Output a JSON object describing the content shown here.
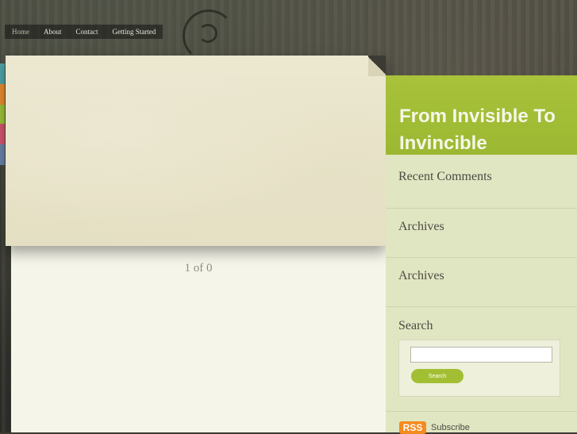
{
  "nav": {
    "items": [
      {
        "label": "Home"
      },
      {
        "label": "About"
      },
      {
        "label": "Contact"
      },
      {
        "label": "Getting Started"
      }
    ]
  },
  "slider": {
    "pager": "1 of 0"
  },
  "site": {
    "title": "From Invisible To Invincible"
  },
  "sidebar": {
    "widgets": [
      {
        "title": "Recent Comments"
      },
      {
        "title": "Archives"
      },
      {
        "title": "Archives"
      },
      {
        "title": "Search"
      }
    ],
    "search": {
      "placeholder": "",
      "button_label": "Search"
    },
    "rss": {
      "badge": "RSS",
      "label": "Subscribe"
    }
  },
  "colors": {
    "accent": "#a2bf33",
    "rss": "#f58a1f",
    "tabs": [
      "#4fa3a8",
      "#e88a2e",
      "#9cc23a",
      "#d2546e",
      "#6b7fa8"
    ]
  }
}
